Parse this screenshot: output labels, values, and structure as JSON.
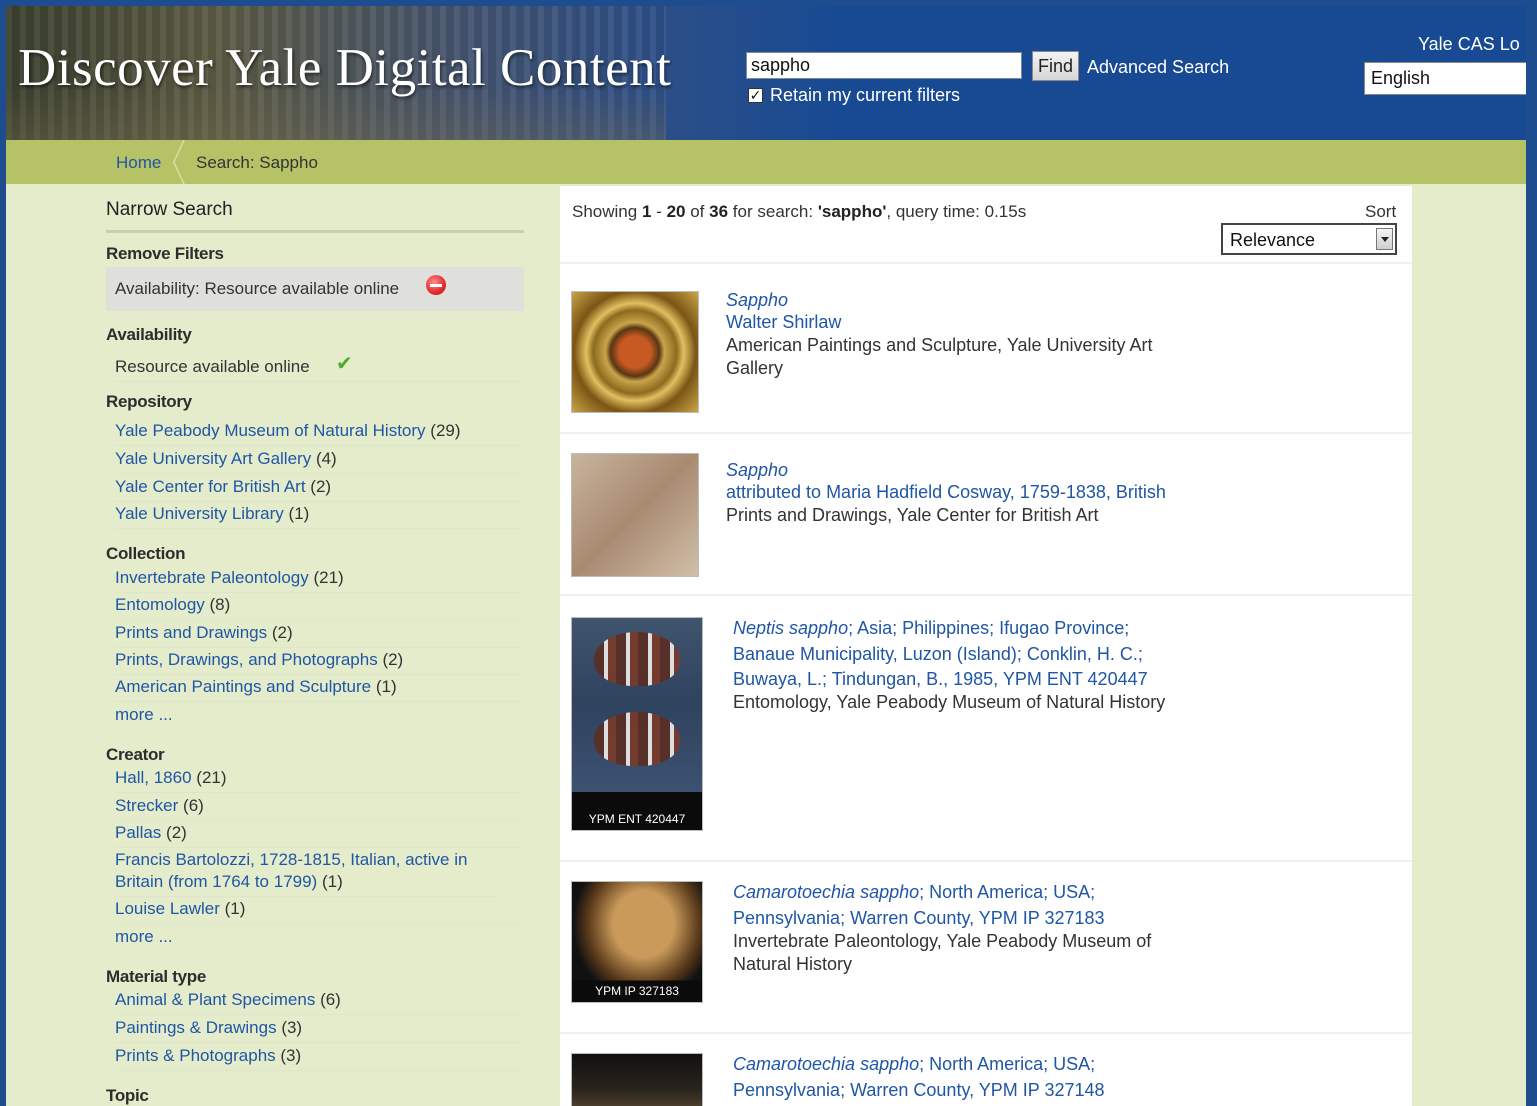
{
  "header": {
    "title": "Discover Yale Digital Content",
    "search_value": "sappho",
    "find_label": "Find",
    "advanced_search_label": "Advanced Search",
    "retain_filters_label": "Retain my current filters",
    "cas_login_label": "Yale CAS Lo",
    "language": "English"
  },
  "breadcrumb": {
    "home": "Home",
    "current": "Search: Sappho"
  },
  "sidebar": {
    "title": "Narrow Search",
    "remove_filters": {
      "heading": "Remove Filters",
      "filter": "Availability: Resource available online"
    },
    "availability": {
      "heading": "Availability",
      "item": "Resource available online"
    },
    "repository": {
      "heading": "Repository",
      "items": [
        {
          "label": "Yale Peabody Museum of Natural History",
          "count": "(29)"
        },
        {
          "label": "Yale University Art Gallery",
          "count": "(4)"
        },
        {
          "label": "Yale Center for British Art",
          "count": "(2)"
        },
        {
          "label": "Yale University Library",
          "count": "(1)"
        }
      ]
    },
    "collection": {
      "heading": "Collection",
      "items": [
        {
          "label": "Invertebrate Paleontology",
          "count": "(21)"
        },
        {
          "label": "Entomology",
          "count": "(8)"
        },
        {
          "label": "Prints and Drawings",
          "count": "(2)"
        },
        {
          "label": "Prints, Drawings, and Photographs",
          "count": "(2)"
        },
        {
          "label": "American Paintings and Sculpture",
          "count": "(1)"
        }
      ],
      "more": "more ..."
    },
    "creator": {
      "heading": "Creator",
      "items": [
        {
          "label": "Hall, 1860",
          "count": "(21)"
        },
        {
          "label": "Strecker",
          "count": "(6)"
        },
        {
          "label": "Pallas",
          "count": "(2)"
        },
        {
          "label": "Francis Bartolozzi, 1728-1815, Italian, active in Britain (from 1764 to 1799)",
          "count": "(1)"
        },
        {
          "label": "Louise Lawler",
          "count": "(1)"
        }
      ],
      "more": "more ..."
    },
    "material_type": {
      "heading": "Material type",
      "items": [
        {
          "label": "Animal & Plant Specimens",
          "count": "(6)"
        },
        {
          "label": "Paintings & Drawings",
          "count": "(3)"
        },
        {
          "label": "Prints & Photographs",
          "count": "(3)"
        }
      ]
    },
    "topic": {
      "heading": "Topic"
    }
  },
  "results": {
    "showing_prefix": "Showing",
    "range_start": "1",
    "range_sep": "-",
    "range_end": "20",
    "of": "of",
    "total": "36",
    "for_search": "for search:",
    "query": "'sappho'",
    "query_time": ", query time: 0.15s",
    "sort_label": "Sort",
    "sort_value": "Relevance",
    "items": [
      {
        "title": "Sappho",
        "author": "Walter Shirlaw",
        "desc1": "American Paintings and Sculpture, Yale University Art",
        "desc2": "Gallery"
      },
      {
        "title": "Sappho",
        "author": "attributed to Maria Hadfield Cosway, 1759-1838, British",
        "desc1": "Prints and Drawings, Yale Center for British Art"
      },
      {
        "title_italic": "Neptis sappho",
        "line1_rest": "; Asia; Philippines; Ifugao Province;",
        "line2": "Banaue Municipality, Luzon (Island); Conklin, H. C.;",
        "line3": "Buwaya, L.; Tindungan, B., 1985, YPM ENT 420447",
        "desc1": "Entomology, Yale Peabody Museum of Natural History",
        "thumb_caption": "YPM ENT 420447"
      },
      {
        "title_italic": "Camarotoechia sappho",
        "line1_rest": "; North America; USA;",
        "line2": "Pennsylvania; Warren County, YPM IP 327183",
        "desc1": "Invertebrate Paleontology, Yale Peabody Museum of",
        "desc2": "Natural History",
        "thumb_caption": "YPM IP 327183"
      },
      {
        "title_italic": "Camarotoechia sappho",
        "line1_rest": "; North America; USA;",
        "line2": "Pennsylvania; Warren County, YPM IP 327148"
      }
    ]
  }
}
